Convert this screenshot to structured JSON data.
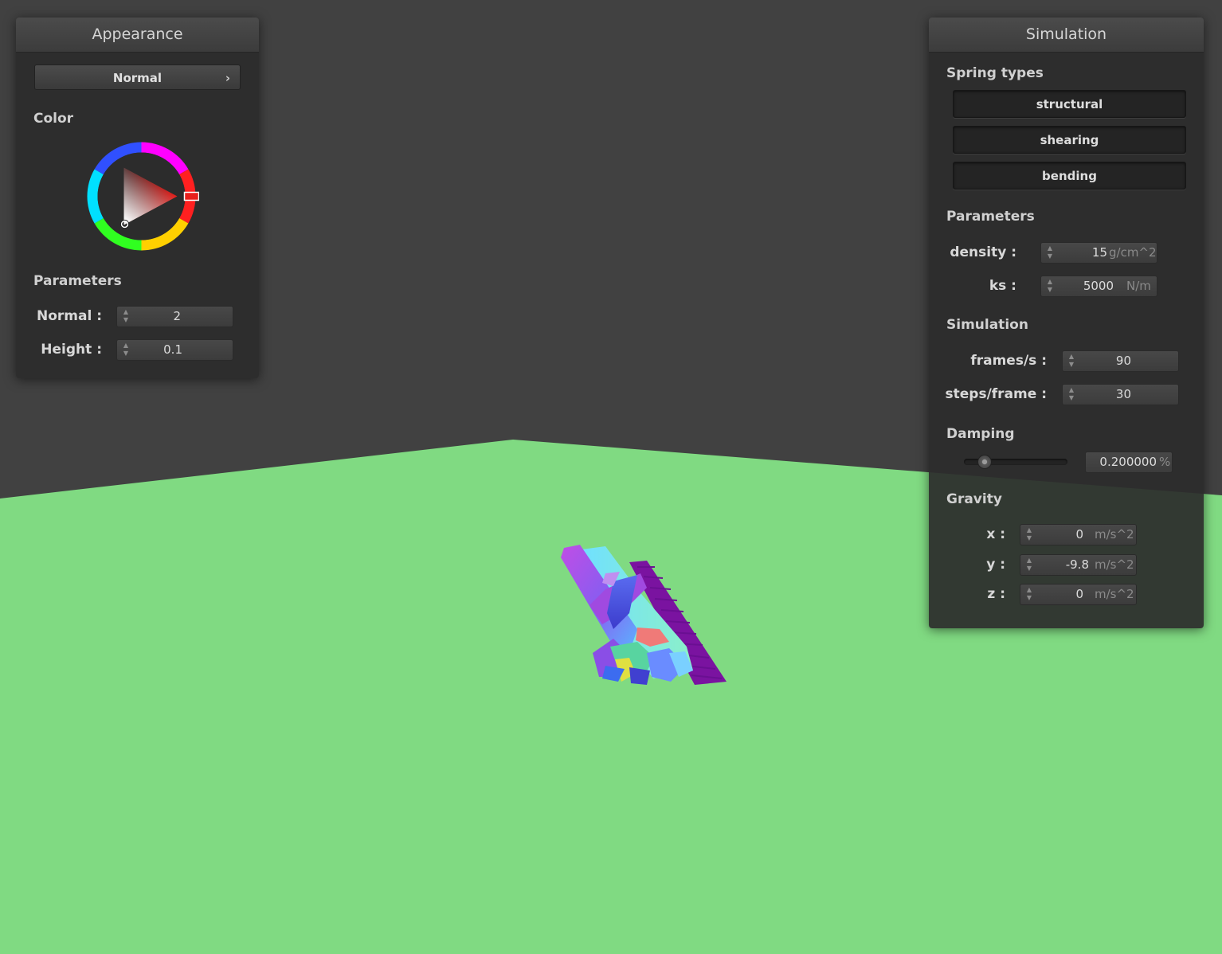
{
  "scene": {
    "background_color": "#414141",
    "floor_color": "#80DA82"
  },
  "appearance": {
    "title": "Appearance",
    "shader_button": {
      "label": "Normal",
      "chevron": "›"
    },
    "color_label": "Color",
    "color_wheel": {
      "selected_hue": "#E8201C",
      "icon": "color-wheel"
    },
    "parameters_label": "Parameters",
    "fields": [
      {
        "label": "Normal :",
        "value": "2"
      },
      {
        "label": "Height :",
        "value": "0.1"
      }
    ]
  },
  "simulation": {
    "title": "Simulation",
    "spring_types_label": "Spring types",
    "spring_buttons": [
      {
        "label": "structural"
      },
      {
        "label": "shearing"
      },
      {
        "label": "bending"
      }
    ],
    "parameters_label": "Parameters",
    "parameters": [
      {
        "label": "density :",
        "value": "15",
        "unit": "g/cm^2"
      },
      {
        "label": "ks :",
        "value": "5000",
        "unit": "N/m"
      }
    ],
    "simulation_label": "Simulation",
    "sim_fields": [
      {
        "label": "frames/s :",
        "value": "90"
      },
      {
        "label": "steps/frame :",
        "value": "30"
      }
    ],
    "damping_label": "Damping",
    "damping": {
      "value": "0.200000",
      "unit": "%",
      "slider_fraction": 0.2
    },
    "gravity_label": "Gravity",
    "gravity": [
      {
        "label": "x :",
        "value": "0",
        "unit": "m/s^2"
      },
      {
        "label": "y :",
        "value": "-9.8",
        "unit": "m/s^2"
      },
      {
        "label": "z :",
        "value": "0",
        "unit": "m/s^2"
      }
    ]
  }
}
